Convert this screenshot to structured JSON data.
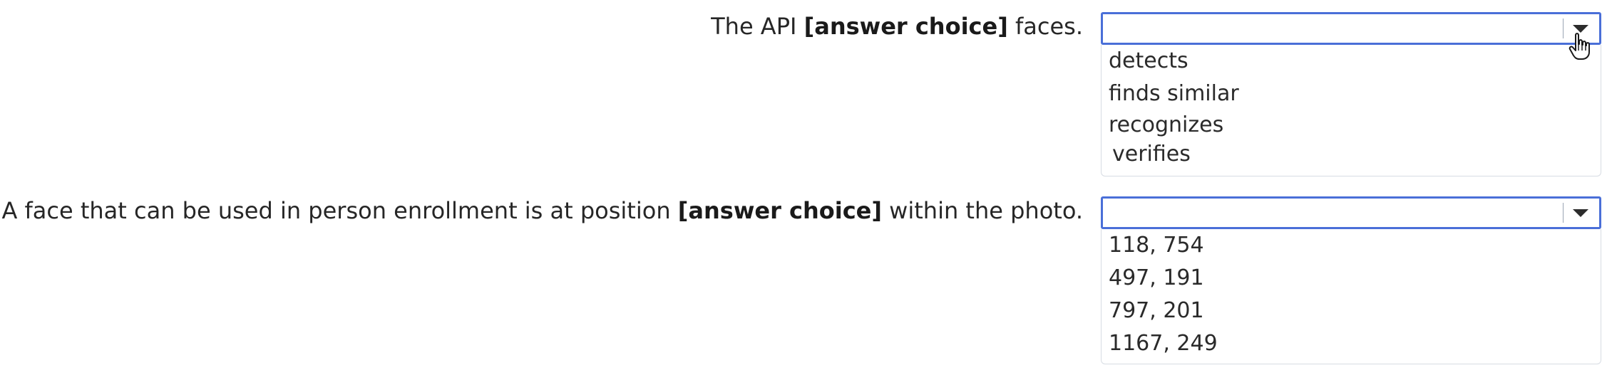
{
  "questions": [
    {
      "prefix": "The API ",
      "choice_marker": "[answer choice]",
      "suffix": " faces.",
      "options": [
        "detects",
        "finds similar",
        "recognizes",
        "verifies"
      ]
    },
    {
      "prefix": "A face that can be used in person enrollment is at position ",
      "choice_marker": "[answer choice]",
      "suffix": " within the photo.",
      "options": [
        "118, 754",
        "497, 191",
        "797, 201",
        "1167, 249"
      ]
    }
  ],
  "colors": {
    "dropdown_border": "#4a6fd8",
    "text": "#262626"
  }
}
